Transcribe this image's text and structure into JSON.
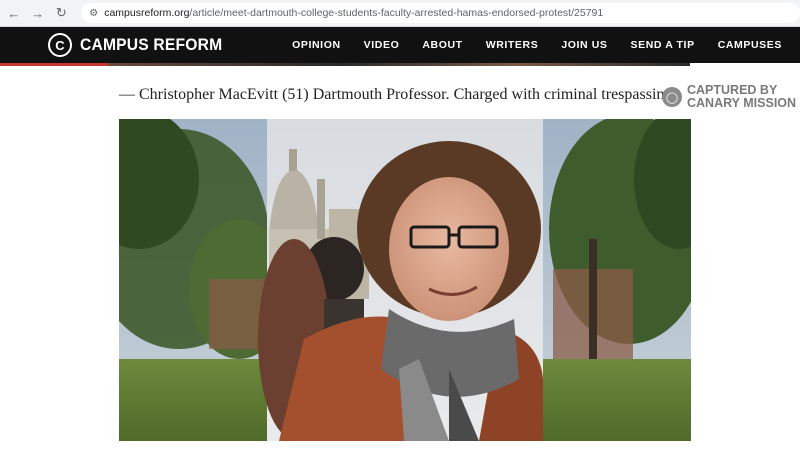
{
  "browser": {
    "url_host": "campusreform.org",
    "url_path": "/article/meet-dartmouth-college-students-faculty-arrested-hamas-endorsed-protest/25791"
  },
  "header": {
    "logo_text": "CAMPUS REFORM",
    "nav": [
      "OPINION",
      "VIDEO",
      "ABOUT",
      "WRITERS",
      "JOIN US",
      "SEND A TIP",
      "CAMPUSES"
    ]
  },
  "article": {
    "caption": "— Christopher MacEvitt (51) Dartmouth Professor. Charged with criminal trespassing.",
    "watermark": {
      "line1": "CAPTURED BY",
      "line2": "CANARY MISSION"
    }
  },
  "colors": {
    "header_bg": "#111111",
    "accent_red": "#c8372d"
  }
}
